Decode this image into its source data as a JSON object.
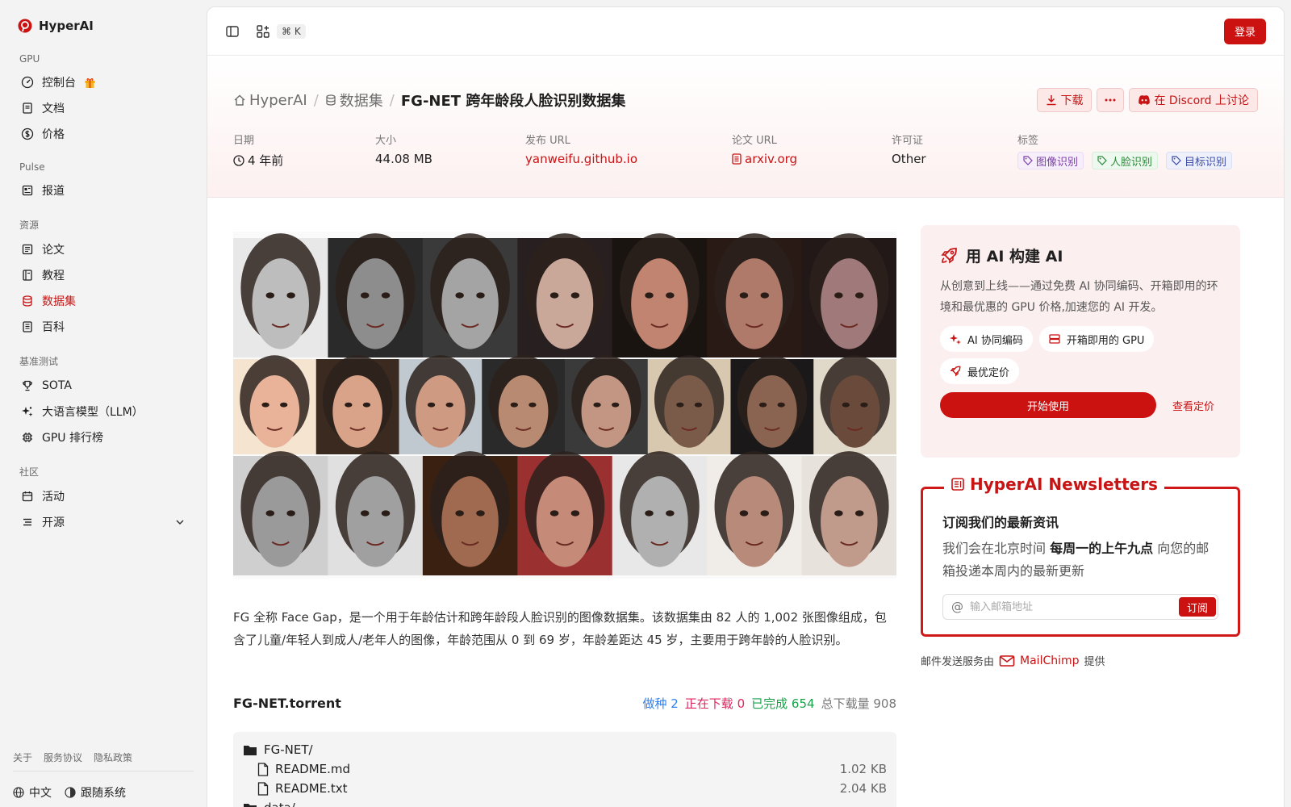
{
  "brand": {
    "name": "HyperAI"
  },
  "sidebar": {
    "sections": [
      {
        "title": "GPU",
        "items": [
          {
            "label": "控制台",
            "icon": "gauge-icon",
            "gift": true
          },
          {
            "label": "文档",
            "icon": "document-icon"
          },
          {
            "label": "价格",
            "icon": "dollar-icon"
          }
        ]
      },
      {
        "title": "Pulse",
        "items": [
          {
            "label": "报道",
            "icon": "newspaper-icon"
          }
        ]
      },
      {
        "title": "资源",
        "items": [
          {
            "label": "论文",
            "icon": "paper-icon"
          },
          {
            "label": "教程",
            "icon": "book-icon"
          },
          {
            "label": "数据集",
            "icon": "database-icon",
            "active": true
          },
          {
            "label": "百科",
            "icon": "encyclopedia-icon"
          }
        ]
      },
      {
        "title": "基准测试",
        "items": [
          {
            "label": "SOTA",
            "icon": "trophy-icon"
          },
          {
            "label": "大语言模型（LLM）",
            "icon": "sparkles-icon"
          },
          {
            "label": "GPU 排行榜",
            "icon": "chip-icon"
          }
        ]
      },
      {
        "title": "社区",
        "items": [
          {
            "label": "活动",
            "icon": "calendar-icon"
          },
          {
            "label": "开源",
            "icon": "list-icon",
            "expandable": true
          }
        ]
      }
    ],
    "footer_links": [
      "关于",
      "服务协议",
      "隐私政策"
    ],
    "language": "中文",
    "tracking": "跟随系统"
  },
  "topbar": {
    "shortcut": "⌘ K",
    "login": "登录"
  },
  "breadcrumb": {
    "home": "HyperAI",
    "section": "数据集",
    "current": "FG-NET 跨年龄段人脸识别数据集"
  },
  "actions": {
    "download": "下载",
    "discord": "在 Discord 上讨论"
  },
  "meta": {
    "date_label": "日期",
    "date_value": "4 年前",
    "size_label": "大小",
    "size_value": "44.08 MB",
    "publish_label": "发布 URL",
    "publish_value": "yanweifu.github.io",
    "paper_label": "论文 URL",
    "paper_value": "arxiv.org",
    "license_label": "许可证",
    "license_value": "Other",
    "tags_label": "标签",
    "tags": [
      "图像识别",
      "人脸识别",
      "目标识别"
    ]
  },
  "description": "FG 全称 Face Gap，是一个用于年龄估计和跨年龄段人脸识别的图像数据集。该数据集由 82 人的 1,002 张图像组成，包含了儿童/年轻人到成人/老年人的图像，年龄范围从 0 到 69 岁，年龄差距达 45 岁，主要用于跨年龄的人脸识别。",
  "torrent": {
    "name": "FG-NET.torrent",
    "seeding_label": "做种",
    "seeding": "2",
    "downloading_label": "正在下载",
    "downloading": "0",
    "completed_label": "已完成",
    "completed": "654",
    "total_label": "总下载量",
    "total": "908",
    "files": [
      {
        "name": "FG-NET/",
        "type": "folder",
        "size": ""
      },
      {
        "name": "README.md",
        "type": "file",
        "size": "1.02 KB"
      },
      {
        "name": "README.txt",
        "type": "file",
        "size": "2.04 KB"
      },
      {
        "name": "data/",
        "type": "folder",
        "size": ""
      }
    ]
  },
  "promo": {
    "title": "用 AI 构建 AI",
    "desc": "从创意到上线——通过免费 AI 协同编码、开箱即用的环境和最优惠的 GPU 价格,加速您的 AI 开发。",
    "chips": [
      "AI 协同编码",
      "开箱即用的 GPU",
      "最优定价"
    ],
    "start": "开始使用",
    "pricing": "查看定价"
  },
  "newsletter": {
    "legend": "HyperAI Newsletters",
    "title": "订阅我们的最新资讯",
    "text_pre": "我们会在北京时间 ",
    "text_bold": "每周一的上午九点",
    "text_post": " 向您的邮箱投递本周内的最新更新",
    "placeholder": "输入邮箱地址",
    "subscribe": "订阅",
    "provider_pre": "邮件发送服务由",
    "provider": "MailChimp",
    "provider_post": "提供"
  },
  "colors": {
    "accent": "#cc1111",
    "seeding": "#2f80ed",
    "downloading": "#e0245e",
    "completed": "#17a34a"
  }
}
